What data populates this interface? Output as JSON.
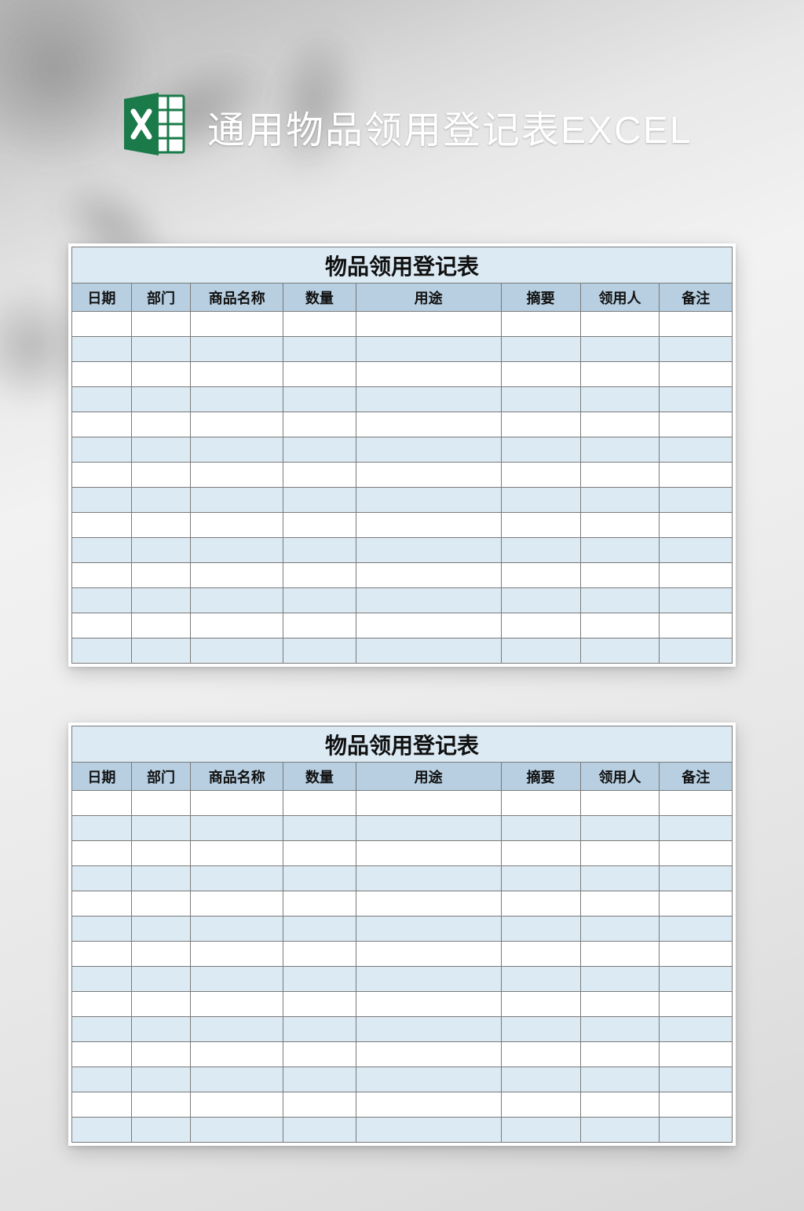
{
  "header": {
    "title": "通用物品领用登记表EXCEL",
    "icon_name": "excel-icon",
    "icon_letter": "X",
    "icon_fill": "#1a7a49",
    "icon_accent": "#ffffff"
  },
  "sheets": [
    {
      "title": "物品领用登记表",
      "columns": [
        "日期",
        "部门",
        "商品名称",
        "数量",
        "用途",
        "摘要",
        "领用人",
        "备注"
      ],
      "rows": [
        [
          "",
          "",
          "",
          "",
          "",
          "",
          "",
          ""
        ],
        [
          "",
          "",
          "",
          "",
          "",
          "",
          "",
          ""
        ],
        [
          "",
          "",
          "",
          "",
          "",
          "",
          "",
          ""
        ],
        [
          "",
          "",
          "",
          "",
          "",
          "",
          "",
          ""
        ],
        [
          "",
          "",
          "",
          "",
          "",
          "",
          "",
          ""
        ],
        [
          "",
          "",
          "",
          "",
          "",
          "",
          "",
          ""
        ],
        [
          "",
          "",
          "",
          "",
          "",
          "",
          "",
          ""
        ],
        [
          "",
          "",
          "",
          "",
          "",
          "",
          "",
          ""
        ],
        [
          "",
          "",
          "",
          "",
          "",
          "",
          "",
          ""
        ],
        [
          "",
          "",
          "",
          "",
          "",
          "",
          "",
          ""
        ],
        [
          "",
          "",
          "",
          "",
          "",
          "",
          "",
          ""
        ],
        [
          "",
          "",
          "",
          "",
          "",
          "",
          "",
          ""
        ],
        [
          "",
          "",
          "",
          "",
          "",
          "",
          "",
          ""
        ],
        [
          "",
          "",
          "",
          "",
          "",
          "",
          "",
          ""
        ]
      ]
    },
    {
      "title": "物品领用登记表",
      "columns": [
        "日期",
        "部门",
        "商品名称",
        "数量",
        "用途",
        "摘要",
        "领用人",
        "备注"
      ],
      "rows": [
        [
          "",
          "",
          "",
          "",
          "",
          "",
          "",
          ""
        ],
        [
          "",
          "",
          "",
          "",
          "",
          "",
          "",
          ""
        ],
        [
          "",
          "",
          "",
          "",
          "",
          "",
          "",
          ""
        ],
        [
          "",
          "",
          "",
          "",
          "",
          "",
          "",
          ""
        ],
        [
          "",
          "",
          "",
          "",
          "",
          "",
          "",
          ""
        ],
        [
          "",
          "",
          "",
          "",
          "",
          "",
          "",
          ""
        ],
        [
          "",
          "",
          "",
          "",
          "",
          "",
          "",
          ""
        ],
        [
          "",
          "",
          "",
          "",
          "",
          "",
          "",
          ""
        ],
        [
          "",
          "",
          "",
          "",
          "",
          "",
          "",
          ""
        ],
        [
          "",
          "",
          "",
          "",
          "",
          "",
          "",
          ""
        ],
        [
          "",
          "",
          "",
          "",
          "",
          "",
          "",
          ""
        ],
        [
          "",
          "",
          "",
          "",
          "",
          "",
          "",
          ""
        ],
        [
          "",
          "",
          "",
          "",
          "",
          "",
          "",
          ""
        ],
        [
          "",
          "",
          "",
          "",
          "",
          "",
          "",
          ""
        ]
      ]
    }
  ]
}
